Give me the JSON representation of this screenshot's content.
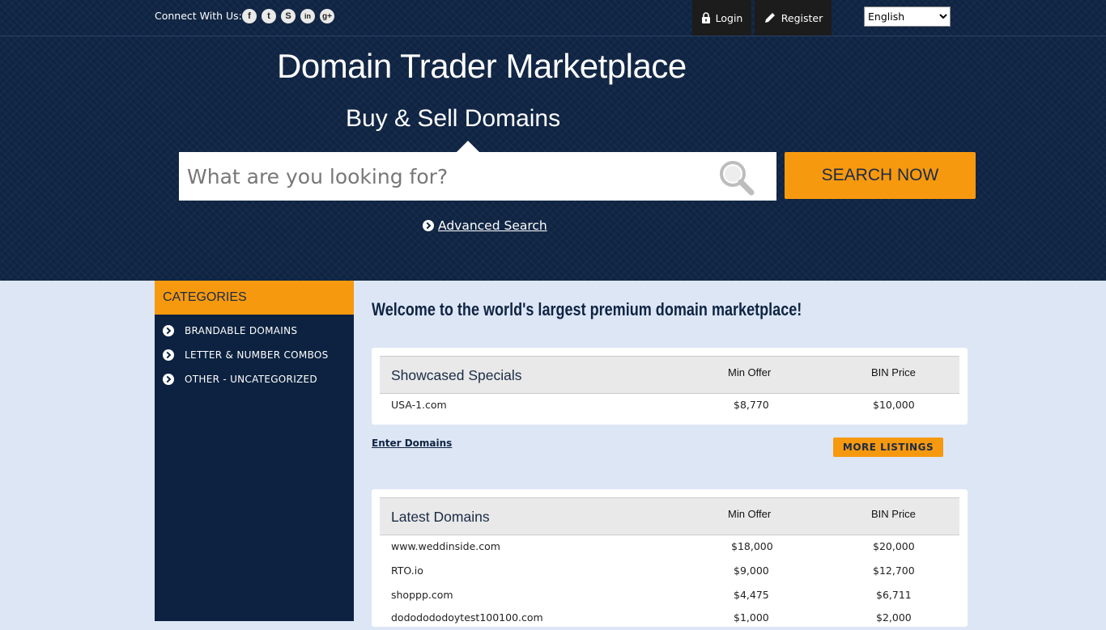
{
  "topbar": {
    "connect_label": "Connect With Us:",
    "social": [
      "facebook-icon",
      "twitter-icon",
      "skype-icon",
      "linkedin-icon",
      "google-plus-icon"
    ],
    "login": "Login",
    "register": "Register",
    "language": "English"
  },
  "hero": {
    "title": "Domain Trader Marketplace",
    "tagline": "Buy & Sell Domains",
    "search_placeholder": "What are you looking for?",
    "search_button": "SEARCH NOW",
    "advanced_search": "Advanced Search"
  },
  "sidebar": {
    "heading": "CATEGORIES",
    "items": [
      {
        "label": "BRANDABLE DOMAINS"
      },
      {
        "label": "LETTER & NUMBER COMBOS"
      },
      {
        "label": "OTHER - UNCATEGORIZED"
      }
    ]
  },
  "main": {
    "welcome": "Welcome to the world's largest premium domain marketplace!",
    "showcased": {
      "title": "Showcased Specials",
      "col_min": "Min Offer",
      "col_bin": "BIN Price",
      "rows": [
        {
          "domain": "USA-1.com",
          "min": "$8,770",
          "bin": "$10,000"
        }
      ]
    },
    "enter_domains": "Enter Domains",
    "more_listings": "MORE LISTINGS",
    "latest": {
      "title": "Latest Domains",
      "col_min": "Min Offer",
      "col_bin": "BIN Price",
      "rows": [
        {
          "domain": "www.weddinside.com",
          "min": "$18,000",
          "bin": "$20,000"
        },
        {
          "domain": "RTO.io",
          "min": "$9,000",
          "bin": "$12,700"
        },
        {
          "domain": "shoppp.com",
          "min": "$4,475",
          "bin": "$6,711"
        },
        {
          "domain": "dododododoytest100100.com",
          "min": "$1,000",
          "bin": "$2,000"
        }
      ]
    }
  },
  "colors": {
    "navy": "#0f2443",
    "orange": "#f7990f",
    "page_bg": "#dde6f5"
  }
}
